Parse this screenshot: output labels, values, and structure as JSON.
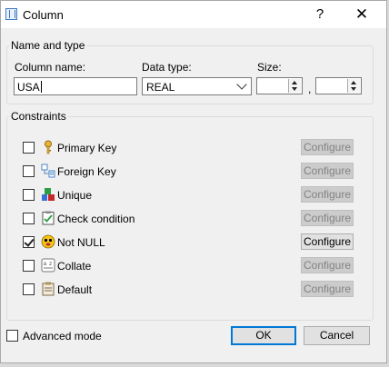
{
  "window": {
    "title": "Column"
  },
  "name_type": {
    "legend": "Name and type",
    "column_name_label": "Column name:",
    "column_name_value": "USA",
    "data_type_label": "Data type:",
    "data_type_value": "REAL",
    "size_label": "Size:",
    "size_separator": ","
  },
  "constraints": {
    "legend": "Constraints",
    "configure_label": "Configure",
    "items": [
      {
        "label": "Primary Key",
        "checked": false,
        "icon": "key-icon",
        "configure_enabled": false
      },
      {
        "label": "Foreign Key",
        "checked": false,
        "icon": "foreign-key-icon",
        "configure_enabled": false
      },
      {
        "label": "Unique",
        "checked": false,
        "icon": "unique-icon",
        "configure_enabled": false
      },
      {
        "label": "Check condition",
        "checked": false,
        "icon": "check-condition-icon",
        "configure_enabled": false
      },
      {
        "label": "Not NULL",
        "checked": true,
        "icon": "not-null-icon",
        "configure_enabled": true
      },
      {
        "label": "Collate",
        "checked": false,
        "icon": "collate-icon",
        "configure_enabled": false
      },
      {
        "label": "Default",
        "checked": false,
        "icon": "default-icon",
        "configure_enabled": false
      }
    ]
  },
  "footer": {
    "advanced_mode_label": "Advanced mode",
    "ok_label": "OK",
    "cancel_label": "Cancel"
  },
  "colors": {
    "dialog_bg": "#f0f0f0",
    "accent": "#0078d7",
    "disabled_button_bg": "#cccccc"
  }
}
